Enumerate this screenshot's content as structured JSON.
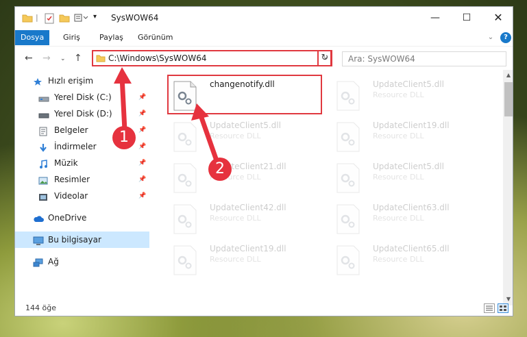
{
  "window": {
    "title": "SysWOW64"
  },
  "ribbon": {
    "tabs": [
      "Dosya",
      "Giriş",
      "Paylaş",
      "Görünüm"
    ]
  },
  "nav": {
    "address": "C:\\Windows\\SysWOW64",
    "search_placeholder": "Ara: SysWOW64"
  },
  "sidebar": {
    "items": [
      {
        "label": "Hızlı erişim",
        "icon": "star-icon"
      },
      {
        "label": "Yerel Disk (C:)",
        "icon": "drive-icon",
        "pinned": true
      },
      {
        "label": "Yerel Disk (D:)",
        "icon": "drive-icon",
        "pinned": true
      },
      {
        "label": "Belgeler",
        "icon": "documents-icon",
        "pinned": true
      },
      {
        "label": "İndirmeler",
        "icon": "download-icon",
        "pinned": true
      },
      {
        "label": "Müzik",
        "icon": "music-icon",
        "pinned": true
      },
      {
        "label": "Resimler",
        "icon": "pictures-icon",
        "pinned": true
      },
      {
        "label": "Videolar",
        "icon": "videos-icon",
        "pinned": true
      },
      {
        "label": "OneDrive",
        "icon": "cloud-icon"
      },
      {
        "label": "Bu bilgisayar",
        "icon": "computer-icon"
      },
      {
        "label": "Ağ",
        "icon": "network-icon"
      }
    ]
  },
  "files": [
    {
      "name": "changenotify.dll",
      "type": ""
    },
    {
      "name": "UpdateClient5.dll",
      "type": "Resource DLL"
    },
    {
      "name": "UpdateClient5.dll",
      "type": "Resource DLL"
    },
    {
      "name": "UpdateClient19.dll",
      "type": "Resource DLL"
    },
    {
      "name": "UpdateClient21.dll",
      "type": "Resource DLL"
    },
    {
      "name": "UpdateClient5.dll",
      "type": "Resource DLL"
    },
    {
      "name": "UpdateClient42.dll",
      "type": "Resource DLL"
    },
    {
      "name": "UpdateClient63.dll",
      "type": "Resource DLL"
    },
    {
      "name": "UpdateClient19.dll",
      "type": "Resource DLL"
    },
    {
      "name": "UpdateClient65.dll",
      "type": "Resource DLL"
    }
  ],
  "status": {
    "count": "144 öğe"
  },
  "callouts": [
    "1",
    "2"
  ],
  "colors": {
    "accent": "#1979ca",
    "highlight": "#e0383f",
    "selection": "#cce8ff"
  }
}
